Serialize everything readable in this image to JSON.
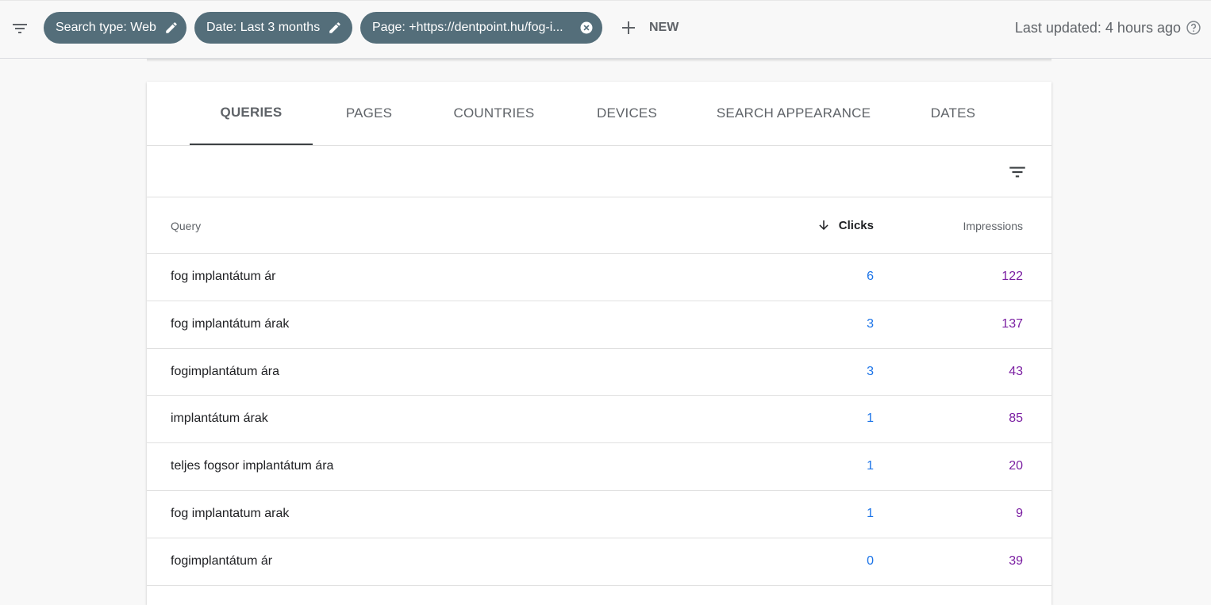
{
  "filters": {
    "chips": [
      {
        "label": "Search type: Web",
        "action_icon": "pencil-icon"
      },
      {
        "label": "Date: Last 3 months",
        "action_icon": "pencil-icon"
      },
      {
        "label": "Page: +https://dentpoint.hu/fog-i...",
        "action_icon": "close-circle-icon"
      }
    ],
    "new_label": "NEW",
    "last_updated": "Last updated: 4 hours ago"
  },
  "tabs": [
    {
      "label": "QUERIES",
      "active": true
    },
    {
      "label": "PAGES",
      "active": false
    },
    {
      "label": "COUNTRIES",
      "active": false
    },
    {
      "label": "DEVICES",
      "active": false
    },
    {
      "label": "SEARCH APPEARANCE",
      "active": false
    },
    {
      "label": "DATES",
      "active": false
    }
  ],
  "table": {
    "columns": {
      "query": "Query",
      "clicks": "Clicks",
      "impressions": "Impressions"
    },
    "sort": {
      "column": "Clicks",
      "direction": "descending"
    },
    "rows": [
      {
        "query": "fog implantátum ár",
        "clicks": "6",
        "impressions": "122"
      },
      {
        "query": "fog implantátum árak",
        "clicks": "3",
        "impressions": "137"
      },
      {
        "query": "fogimplantátum ára",
        "clicks": "3",
        "impressions": "43"
      },
      {
        "query": "implantátum árak",
        "clicks": "1",
        "impressions": "85"
      },
      {
        "query": "teljes fogsor implantátum ára",
        "clicks": "1",
        "impressions": "20"
      },
      {
        "query": "fog implantatum arak",
        "clicks": "1",
        "impressions": "9"
      },
      {
        "query": "fogimplantátum ár",
        "clicks": "0",
        "impressions": "39"
      }
    ]
  },
  "colors": {
    "chip_bg": "#546e7a",
    "clicks": "#1a73e8",
    "impressions": "#7b1fa2"
  }
}
